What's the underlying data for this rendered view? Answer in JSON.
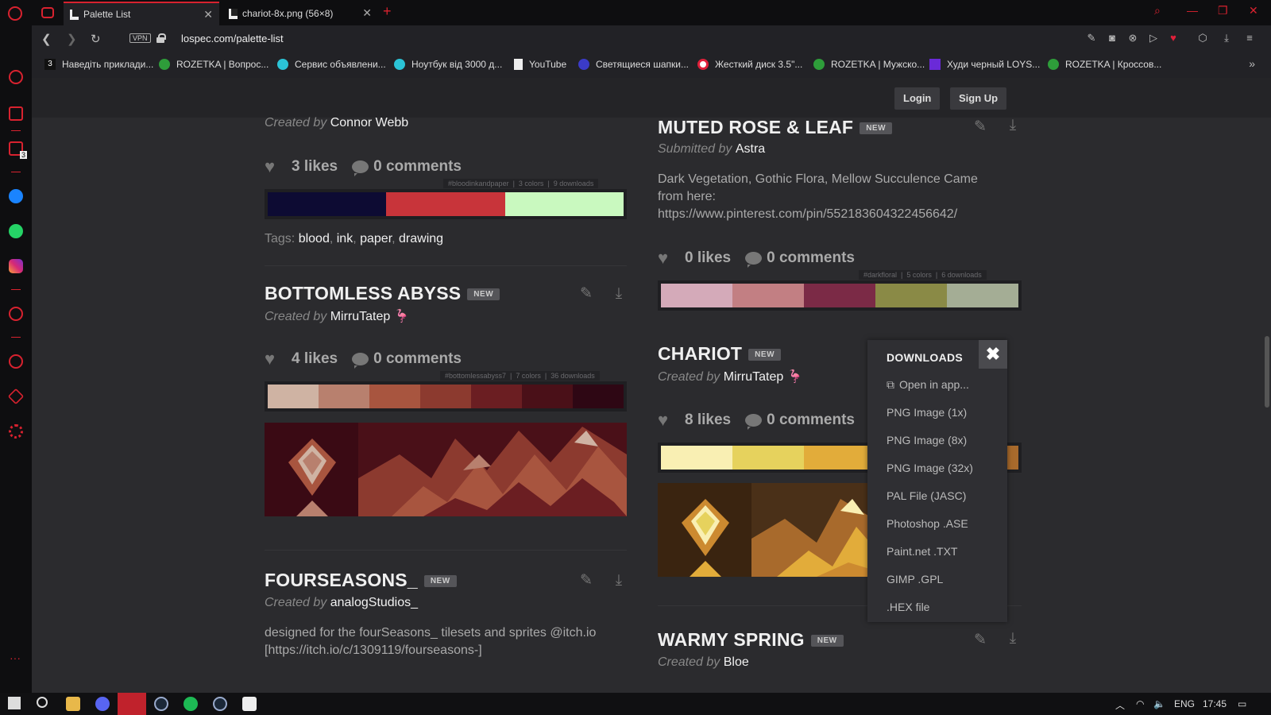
{
  "browser": {
    "tabs": [
      {
        "label": "Palette List"
      },
      {
        "label": "chariot-8x.png (56×8)"
      }
    ],
    "url": "lospec.com/palette-list",
    "vpn_label": "VPN",
    "bookmarks": [
      {
        "label": "Наведіть приклади..."
      },
      {
        "label": "ROZETKA | Вопрос..."
      },
      {
        "label": "Сервис объявлени..."
      },
      {
        "label": "Ноутбук від 3000 д..."
      },
      {
        "label": "YouTube"
      },
      {
        "label": "Светящиеся шапки..."
      },
      {
        "label": "Жесткий диск 3.5\"..."
      },
      {
        "label": "ROZETKA | Мужско..."
      },
      {
        "label": "Худи черный LOYS..."
      },
      {
        "label": "ROZETKA | Кроссов..."
      }
    ],
    "sidebar_badge": "3"
  },
  "site": {
    "login_label": "Login",
    "signup_label": "Sign Up"
  },
  "left": {
    "top_palette": {
      "byline_prefix": "Created by",
      "author": "Connor Webb",
      "likes": "3 likes",
      "comments": "0 comments",
      "meta_tag": "#bloodinkandpaper",
      "meta_colors": "3 colors",
      "meta_downloads": "9 downloads",
      "colors": [
        "#0d0b33",
        "#c8343a",
        "#c9f9bf"
      ],
      "tags_label": "Tags:",
      "tags": [
        "blood",
        "ink",
        "paper",
        "drawing"
      ]
    },
    "bottomless": {
      "title": "BOTTOMLESS ABYSS",
      "badge": "NEW",
      "byline_prefix": "Created by",
      "author": "MirruTatep",
      "likes": "4 likes",
      "comments": "0 comments",
      "meta_tag": "#bottomlessabyss7",
      "meta_colors": "7 colors",
      "meta_downloads": "36 downloads",
      "colors": [
        "#cfb3a3",
        "#b8806e",
        "#a8553f",
        "#8c3a2f",
        "#6b1e22",
        "#4a1018",
        "#2e0714"
      ]
    },
    "fourseasons": {
      "title": "FOURSEASONS_",
      "badge": "NEW",
      "byline_prefix": "Created by",
      "author": "analogStudios_",
      "description_line1": "designed for the fourSeasons_ tilesets and sprites @itch.io",
      "description_line2": "[https://itch.io/c/1309119/fourseasons-]"
    }
  },
  "right": {
    "muted": {
      "title": "MUTED ROSE & LEAF",
      "badge": "NEW",
      "byline_prefix": "Submitted by",
      "author": "Astra",
      "description_line1": "Dark Vegetation, Gothic Flora, Mellow Succulence Came",
      "description_line2": "from here:",
      "description_line3": "https://www.pinterest.com/pin/552183604322456642/",
      "likes": "0 likes",
      "comments": "0 comments",
      "meta_tag": "#darkfloral",
      "meta_colors": "5 colors",
      "meta_downloads": "6 downloads",
      "colors": [
        "#d4aab9",
        "#c27f83",
        "#7b2a46",
        "#8a8a46",
        "#a4ad95"
      ]
    },
    "chariot": {
      "title": "CHARIOT",
      "badge": "NEW",
      "byline_prefix": "Created by",
      "author": "MirruTatep",
      "likes": "8 likes",
      "comments": "0 comments",
      "colors": [
        "#f9efb3",
        "#e6d25d",
        "#e2ac3a",
        "#cc8a30",
        "#a86a2c"
      ]
    },
    "warmy": {
      "title": "WARMY SPRING",
      "badge": "NEW",
      "byline_prefix": "Created by",
      "author": "Bloe"
    }
  },
  "downloads_popup": {
    "heading": "DOWNLOADS",
    "items": [
      {
        "label": "Open in app..."
      },
      {
        "label": "PNG Image (1x)"
      },
      {
        "label": "PNG Image (8x)"
      },
      {
        "label": "PNG Image (32x)"
      },
      {
        "label": "PAL File (JASC)"
      },
      {
        "label": "Photoshop .ASE"
      },
      {
        "label": "Paint.net .TXT"
      },
      {
        "label": "GIMP .GPL"
      },
      {
        "label": ".HEX file"
      }
    ]
  },
  "taskbar": {
    "lang": "ENG",
    "time": "17:45"
  },
  "colors": {
    "accent": "#d8222f",
    "page_bg": "#2b2b2e"
  }
}
